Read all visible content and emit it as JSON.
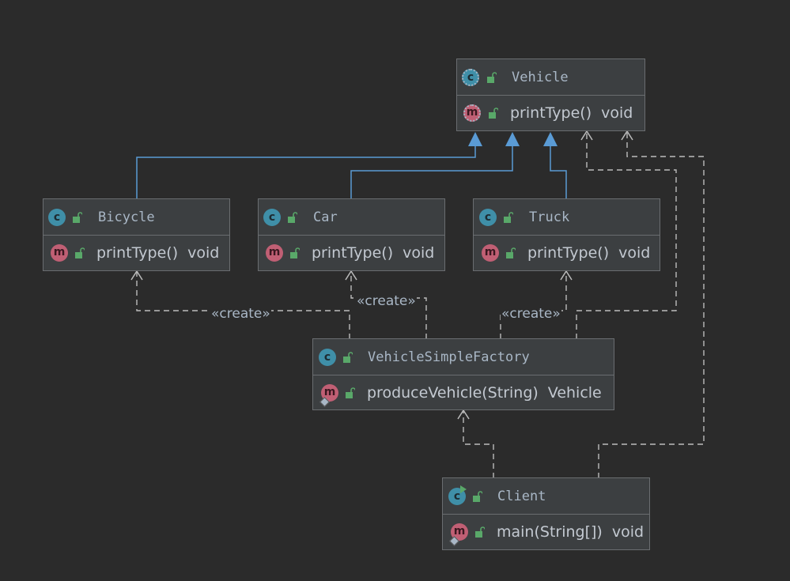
{
  "diagram": {
    "classes": {
      "vehicle": {
        "name": "Vehicle",
        "method": "printType()",
        "return": "void",
        "icon": "abstract-class-icon"
      },
      "bicycle": {
        "name": "Bicycle",
        "method": "printType()",
        "return": "void",
        "icon": "class-icon"
      },
      "car": {
        "name": "Car",
        "method": "printType()",
        "return": "void",
        "icon": "class-icon"
      },
      "truck": {
        "name": "Truck",
        "method": "printType()",
        "return": "void",
        "icon": "class-icon"
      },
      "factory": {
        "name": "VehicleSimpleFactory",
        "method": "produceVehicle(String)",
        "return": "Vehicle",
        "icon": "class-icon"
      },
      "client": {
        "name": "Client",
        "method": "main(String[])",
        "return": "void",
        "icon": "runnable-class-icon"
      }
    },
    "icon_letters": {
      "class": "c",
      "method": "m"
    },
    "stereotypes": {
      "bicycle": "«create»",
      "car": "«create»",
      "truck": "«create»"
    },
    "relations": [
      {
        "from": "Bicycle",
        "to": "Vehicle",
        "kind": "generalization"
      },
      {
        "from": "Car",
        "to": "Vehicle",
        "kind": "generalization"
      },
      {
        "from": "Truck",
        "to": "Vehicle",
        "kind": "generalization"
      },
      {
        "from": "VehicleSimpleFactory",
        "to": "Bicycle",
        "kind": "create"
      },
      {
        "from": "VehicleSimpleFactory",
        "to": "Car",
        "kind": "create"
      },
      {
        "from": "VehicleSimpleFactory",
        "to": "Truck",
        "kind": "create"
      },
      {
        "from": "VehicleSimpleFactory",
        "to": "Vehicle",
        "kind": "dependency"
      },
      {
        "from": "Client",
        "to": "VehicleSimpleFactory",
        "kind": "dependency"
      },
      {
        "from": "Client",
        "to": "Vehicle",
        "kind": "dependency"
      }
    ]
  },
  "colors": {
    "background": "#2b2b2b",
    "box_fill": "#3c3f41",
    "box_border": "#6a6d70",
    "generalization_line": "#5a9bd5",
    "dependency_line": "#bcbcbc",
    "class_icon": "#3f8fa8",
    "method_icon": "#c05f74",
    "public_lock": "#59a869"
  }
}
